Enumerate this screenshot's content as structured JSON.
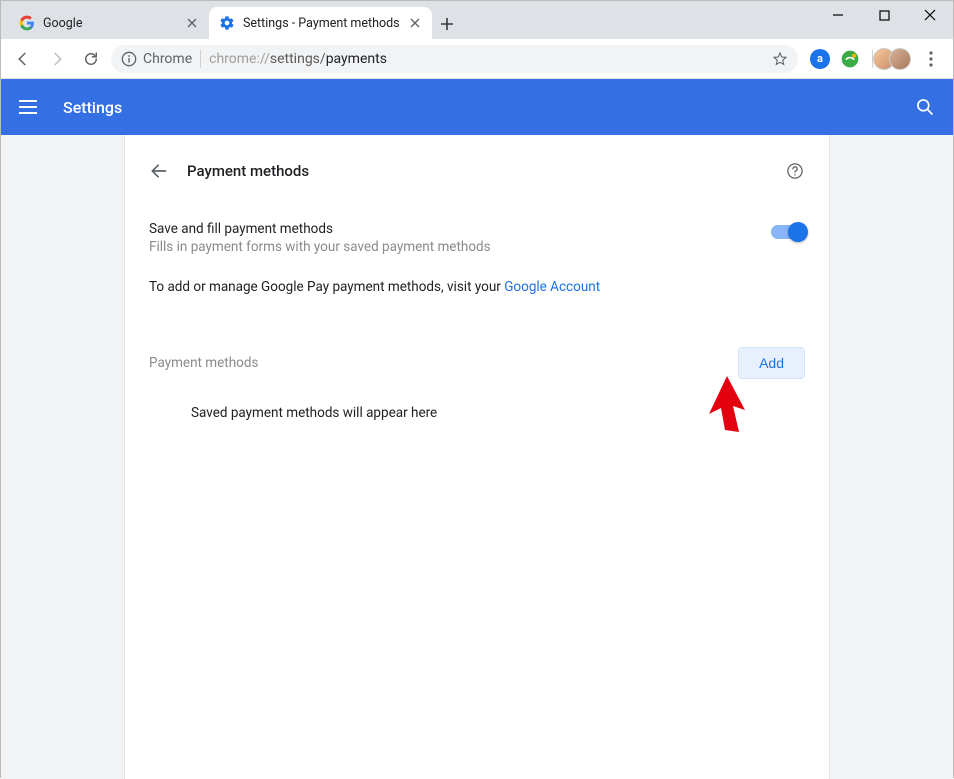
{
  "window": {
    "tabs": [
      {
        "title": "Google",
        "favicon": "google"
      },
      {
        "title": "Settings - Payment methods",
        "favicon": "cog"
      }
    ]
  },
  "omnibox": {
    "secure_label": "Chrome",
    "url_prefix": "chrome://",
    "url_path1": "settings/",
    "url_path2": "payments"
  },
  "header": {
    "title": "Settings"
  },
  "page": {
    "section_title": "Payment methods",
    "save_fill": {
      "title": "Save and fill payment methods",
      "subtitle": "Fills in payment forms with your saved payment methods",
      "enabled": true
    },
    "gpay_prefix": "To add or manage Google Pay payment methods, visit your ",
    "gpay_link": "Google Account",
    "subsection_label": "Payment methods",
    "add_button": "Add",
    "empty_state": "Saved payment methods will appear here"
  }
}
